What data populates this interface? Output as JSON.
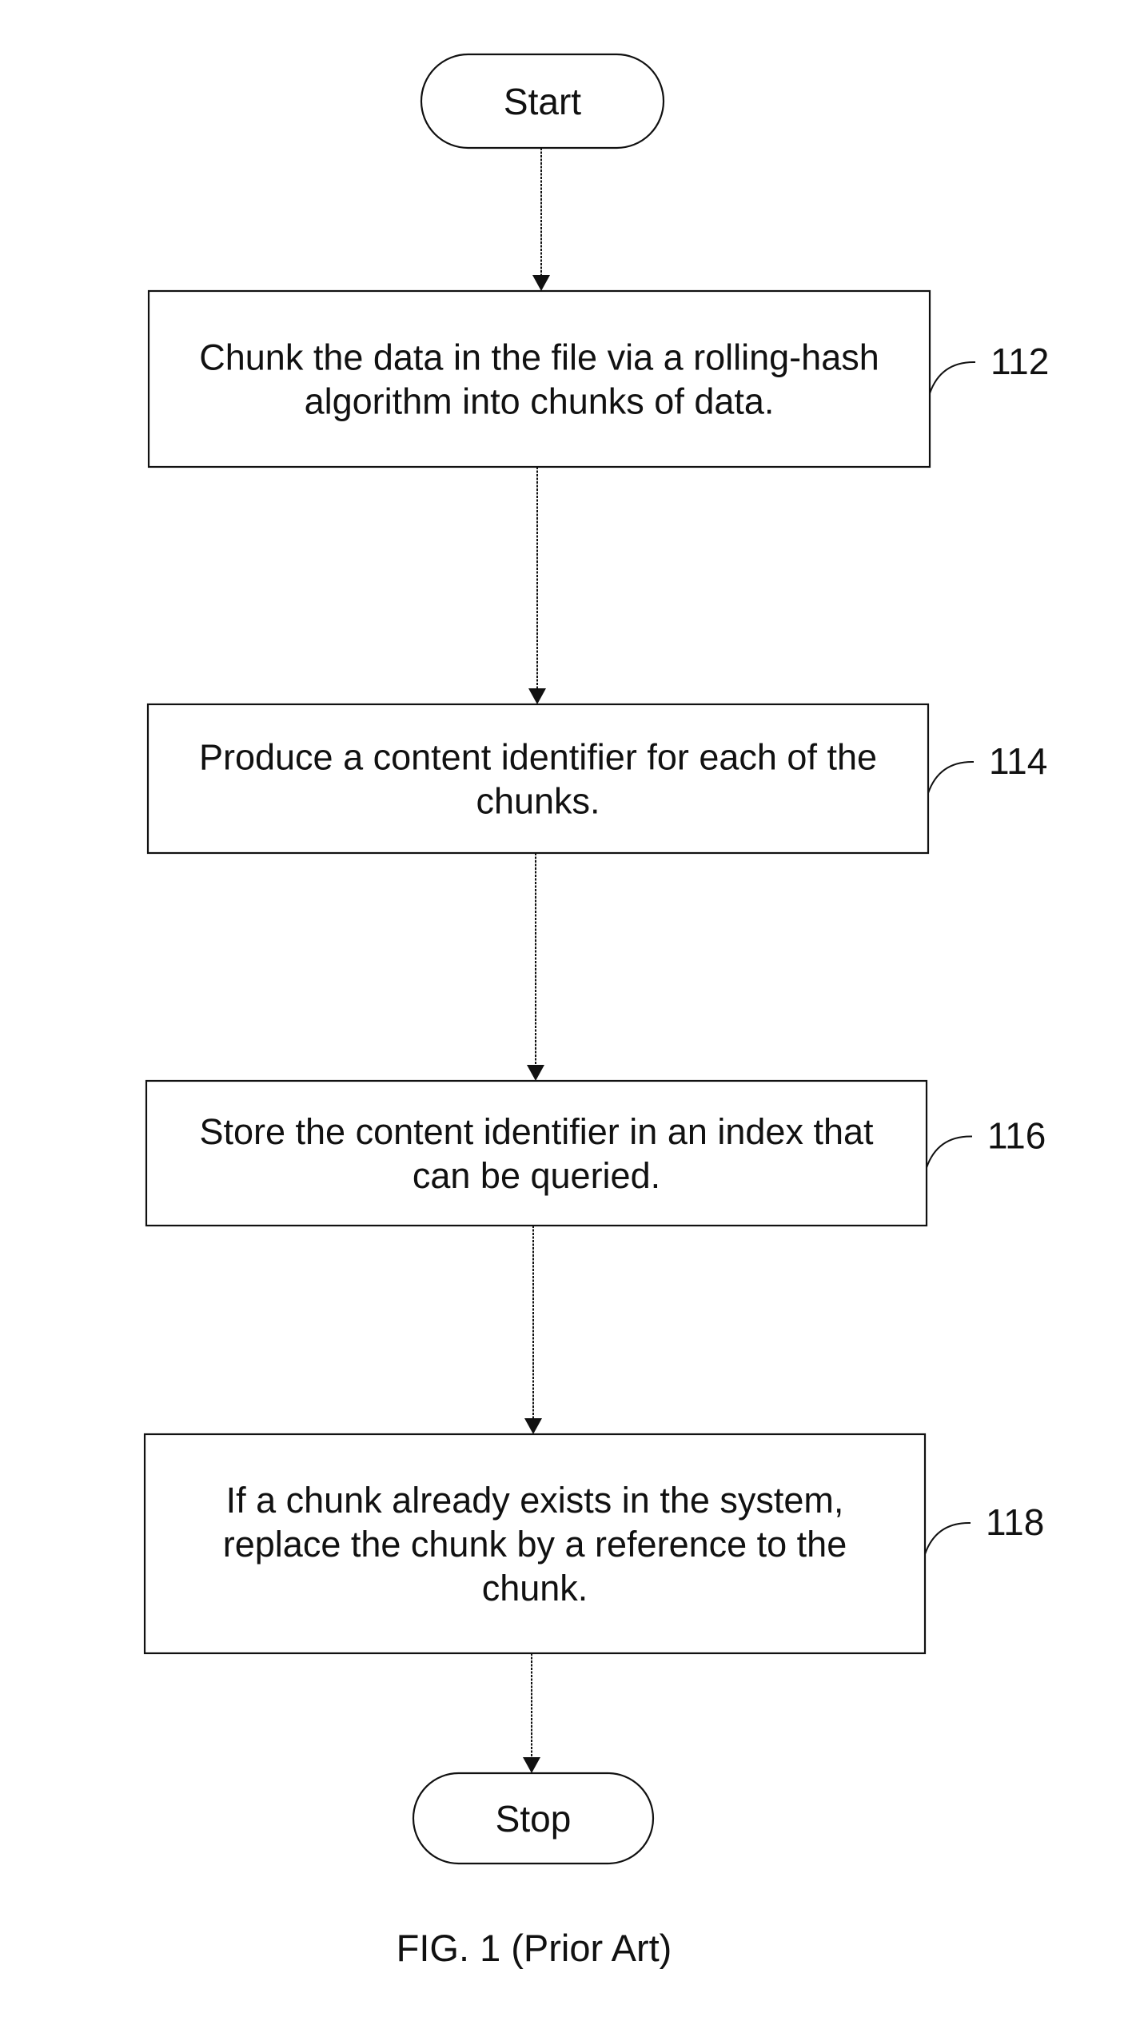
{
  "figure": {
    "caption": "FIG. 1 (Prior Art)"
  },
  "nodes": [
    {
      "id": "start",
      "type": "terminal",
      "lines": [
        "Start"
      ]
    },
    {
      "id": "step-112",
      "type": "process",
      "ref": "112",
      "lines": [
        "Chunk the data in the file via a rolling-hash",
        "algorithm into chunks of data."
      ]
    },
    {
      "id": "step-114",
      "type": "process",
      "ref": "114",
      "lines": [
        "Produce a content identifier for each of the",
        "chunks."
      ]
    },
    {
      "id": "step-116",
      "type": "process",
      "ref": "116",
      "lines": [
        "Store the content identifier in an index that",
        "can be queried."
      ]
    },
    {
      "id": "step-118",
      "type": "process",
      "ref": "118",
      "lines": [
        "If a chunk already exists in the system,",
        "replace the chunk by a reference to the",
        "chunk."
      ]
    },
    {
      "id": "stop",
      "type": "terminal",
      "lines": [
        "Stop"
      ]
    }
  ],
  "edges": [
    {
      "from": "start",
      "to": "step-112"
    },
    {
      "from": "step-112",
      "to": "step-114"
    },
    {
      "from": "step-114",
      "to": "step-116"
    },
    {
      "from": "step-116",
      "to": "step-118"
    },
    {
      "from": "step-118",
      "to": "stop"
    }
  ],
  "colors": {
    "ink": "#111111",
    "background": "#ffffff"
  }
}
